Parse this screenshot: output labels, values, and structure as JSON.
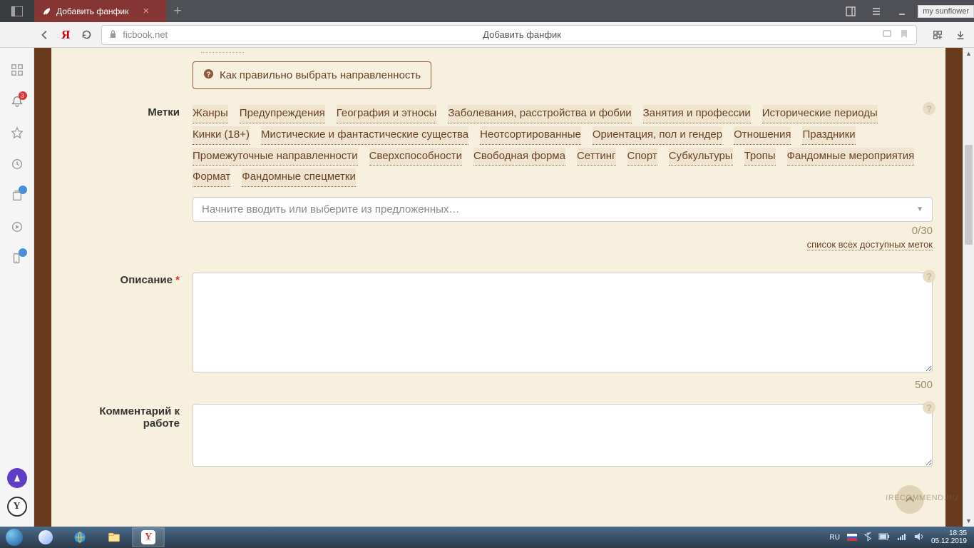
{
  "browser": {
    "tab_title": "Добавить фанфик",
    "url": "ficbook.net",
    "page_title": "Добавить фанфик",
    "username": "my sunflower",
    "notif_count": "3"
  },
  "hint": "Как правильно выбрать направленность",
  "labels": {
    "tags": "Метки",
    "description": "Описание",
    "comment": "Комментарий к работе"
  },
  "tags": [
    "Жанры",
    "Предупреждения",
    "География и этносы",
    "Заболевания, расстройства и фобии",
    "Занятия и профессии",
    "Исторические периоды",
    "Кинки (18+)",
    "Мистические и фантастические существа",
    "Неотсортированные",
    "Ориентация, пол и гендер",
    "Отношения",
    "Праздники",
    "Промежуточные направленности",
    "Сверхспособности",
    "Свободная форма",
    "Сеттинг",
    "Спорт",
    "Субкультуры",
    "Тропы",
    "Фандомные мероприятия",
    "Формат",
    "Фандомные спецметки"
  ],
  "tags_placeholder": "Начните вводить или выберите из предложенных…",
  "tags_counter": "0/30",
  "all_tags_link": "список всех доступных меток",
  "desc_counter": "500",
  "tray": {
    "lang": "RU",
    "time": "18:35",
    "date": "05.12.2019"
  },
  "watermark": "IRECOMMEND.RU"
}
